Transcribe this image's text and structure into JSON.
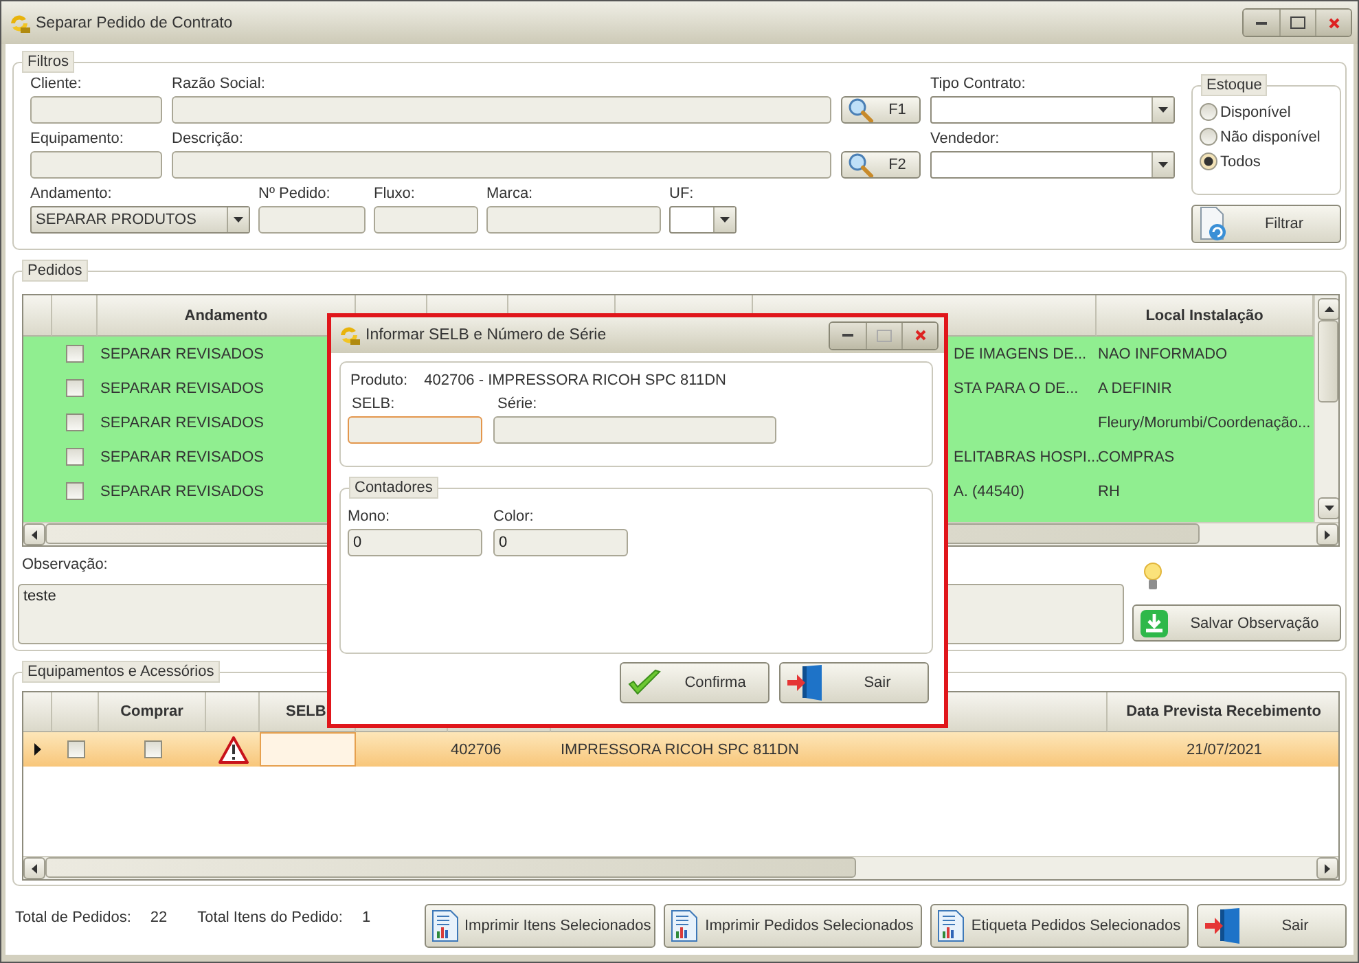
{
  "window": {
    "title": "Separar Pedido de Contrato"
  },
  "filtros": {
    "title": "Filtros",
    "row_1": [
      {
        "kind": "field",
        "label": "Cliente:"
      },
      {
        "kind": "field",
        "label": "Razão Social:"
      },
      {
        "kind": "search",
        "label": "F1"
      },
      {
        "kind": "combo",
        "label": "Tipo Contrato:"
      }
    ],
    "row_2": [
      {
        "kind": "field",
        "label": "Equipamento:"
      },
      {
        "kind": "field",
        "label": "Descrição:"
      },
      {
        "kind": "search",
        "label": "F2"
      },
      {
        "kind": "combo",
        "label": "Vendedor:"
      }
    ],
    "row_3": [
      {
        "kind": "combo",
        "label": "Andamento:",
        "value": "SEPARAR PRODUTOS"
      },
      {
        "kind": "field",
        "label": "Nº Pedido:"
      },
      {
        "kind": "field",
        "label": "Fluxo:"
      },
      {
        "kind": "field",
        "label": "Marca:"
      },
      {
        "kind": "combo",
        "label": "UF:"
      }
    ],
    "estoque": {
      "title": "Estoque",
      "options": [
        {
          "label": "Disponível",
          "selected": false
        },
        {
          "label": "Não disponível",
          "selected": false
        },
        {
          "label": "Todos",
          "selected": true
        }
      ]
    },
    "filtrar_button": "Filtrar"
  },
  "pedidos": {
    "title": "Pedidos",
    "columns": [
      {
        "label": "Andamento"
      },
      {
        "label": "Local Instalação"
      }
    ],
    "rows": [
      {
        "checked": false,
        "andamento": "SEPARAR REVISADOS",
        "column_8": "DE IMAGENS DE...",
        "local_instalacao": "NAO INFORMADO"
      },
      {
        "checked": false,
        "andamento": "SEPARAR REVISADOS",
        "column_8": "STA PARA O DE...",
        "local_instalacao": "A DEFINIR"
      },
      {
        "checked": false,
        "andamento": "SEPARAR REVISADOS",
        "local_instalacao": "Fleury/Morumbi/Coordenação..."
      },
      {
        "checked": false,
        "andamento": "SEPARAR REVISADOS",
        "column_8": "ELITABRAS HOSPI...",
        "local_instalacao": "COMPRAS"
      },
      {
        "checked": false,
        "andamento": "SEPARAR REVISADOS",
        "column_8": "A. (44540)",
        "local_instalacao": "RH"
      }
    ],
    "observacao": {
      "label": "Observação:",
      "value": "teste"
    },
    "save_button": "Salvar Observação"
  },
  "equipamentos": {
    "title": "Equipamentos e Acessórios",
    "columns": [
      {
        "label": "Comprar"
      },
      {
        "label": "SELB"
      },
      {
        "label": "Data Prevista Recebimento"
      }
    ],
    "rows": [
      {
        "selected": true,
        "checked": false,
        "comprar": false,
        "warning": true,
        "codigo": "402706",
        "descricao": "IMPRESSORA RICOH SPC 811DN",
        "data": "21/07/2021"
      }
    ]
  },
  "footer": {
    "totals": [
      {
        "label": "Total de Pedidos:",
        "value": "22"
      },
      {
        "label": "Total Itens do Pedido:",
        "value": "1"
      }
    ],
    "buttons": [
      {
        "label": "Imprimir Itens Selecionados",
        "kind": "report"
      },
      {
        "label": "Imprimir Pedidos Selecionados",
        "kind": "report"
      },
      {
        "label": "Etiqueta Pedidos Selecionados",
        "kind": "report"
      },
      {
        "label": "Sair",
        "kind": "exit"
      }
    ]
  },
  "dialog": {
    "title": "Informar SELB e Número de Série",
    "produto_label": "Produto:",
    "produto": "402706 - IMPRESSORA RICOH SPC 811DN",
    "selb_label": "SELB:",
    "serie_label": "Série:",
    "contadores": {
      "title": "Contadores",
      "fields": [
        {
          "label": "Mono:",
          "value": "0"
        },
        {
          "label": "Color:",
          "value": "0"
        }
      ]
    },
    "buttons": [
      {
        "label": "Confirma",
        "kind": "confirm"
      },
      {
        "label": "Sair",
        "kind": "exit"
      }
    ]
  }
}
